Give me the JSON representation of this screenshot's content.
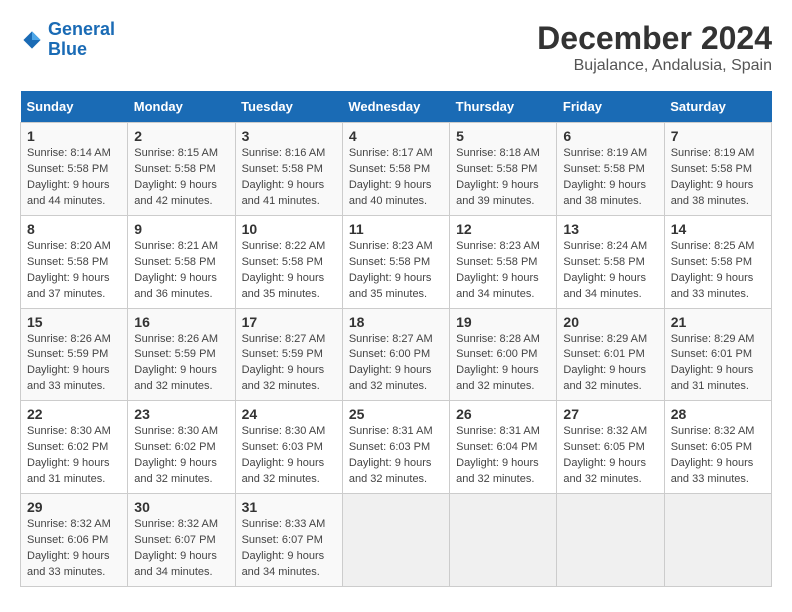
{
  "logo": {
    "line1": "General",
    "line2": "Blue"
  },
  "title": "December 2024",
  "subtitle": "Bujalance, Andalusia, Spain",
  "days_header": [
    "Sunday",
    "Monday",
    "Tuesday",
    "Wednesday",
    "Thursday",
    "Friday",
    "Saturday"
  ],
  "weeks": [
    [
      {
        "day": "1",
        "sunrise": "Sunrise: 8:14 AM",
        "sunset": "Sunset: 5:58 PM",
        "daylight": "Daylight: 9 hours and 44 minutes."
      },
      {
        "day": "2",
        "sunrise": "Sunrise: 8:15 AM",
        "sunset": "Sunset: 5:58 PM",
        "daylight": "Daylight: 9 hours and 42 minutes."
      },
      {
        "day": "3",
        "sunrise": "Sunrise: 8:16 AM",
        "sunset": "Sunset: 5:58 PM",
        "daylight": "Daylight: 9 hours and 41 minutes."
      },
      {
        "day": "4",
        "sunrise": "Sunrise: 8:17 AM",
        "sunset": "Sunset: 5:58 PM",
        "daylight": "Daylight: 9 hours and 40 minutes."
      },
      {
        "day": "5",
        "sunrise": "Sunrise: 8:18 AM",
        "sunset": "Sunset: 5:58 PM",
        "daylight": "Daylight: 9 hours and 39 minutes."
      },
      {
        "day": "6",
        "sunrise": "Sunrise: 8:19 AM",
        "sunset": "Sunset: 5:58 PM",
        "daylight": "Daylight: 9 hours and 38 minutes."
      },
      {
        "day": "7",
        "sunrise": "Sunrise: 8:19 AM",
        "sunset": "Sunset: 5:58 PM",
        "daylight": "Daylight: 9 hours and 38 minutes."
      }
    ],
    [
      {
        "day": "8",
        "sunrise": "Sunrise: 8:20 AM",
        "sunset": "Sunset: 5:58 PM",
        "daylight": "Daylight: 9 hours and 37 minutes."
      },
      {
        "day": "9",
        "sunrise": "Sunrise: 8:21 AM",
        "sunset": "Sunset: 5:58 PM",
        "daylight": "Daylight: 9 hours and 36 minutes."
      },
      {
        "day": "10",
        "sunrise": "Sunrise: 8:22 AM",
        "sunset": "Sunset: 5:58 PM",
        "daylight": "Daylight: 9 hours and 35 minutes."
      },
      {
        "day": "11",
        "sunrise": "Sunrise: 8:23 AM",
        "sunset": "Sunset: 5:58 PM",
        "daylight": "Daylight: 9 hours and 35 minutes."
      },
      {
        "day": "12",
        "sunrise": "Sunrise: 8:23 AM",
        "sunset": "Sunset: 5:58 PM",
        "daylight": "Daylight: 9 hours and 34 minutes."
      },
      {
        "day": "13",
        "sunrise": "Sunrise: 8:24 AM",
        "sunset": "Sunset: 5:58 PM",
        "daylight": "Daylight: 9 hours and 34 minutes."
      },
      {
        "day": "14",
        "sunrise": "Sunrise: 8:25 AM",
        "sunset": "Sunset: 5:58 PM",
        "daylight": "Daylight: 9 hours and 33 minutes."
      }
    ],
    [
      {
        "day": "15",
        "sunrise": "Sunrise: 8:26 AM",
        "sunset": "Sunset: 5:59 PM",
        "daylight": "Daylight: 9 hours and 33 minutes."
      },
      {
        "day": "16",
        "sunrise": "Sunrise: 8:26 AM",
        "sunset": "Sunset: 5:59 PM",
        "daylight": "Daylight: 9 hours and 32 minutes."
      },
      {
        "day": "17",
        "sunrise": "Sunrise: 8:27 AM",
        "sunset": "Sunset: 5:59 PM",
        "daylight": "Daylight: 9 hours and 32 minutes."
      },
      {
        "day": "18",
        "sunrise": "Sunrise: 8:27 AM",
        "sunset": "Sunset: 6:00 PM",
        "daylight": "Daylight: 9 hours and 32 minutes."
      },
      {
        "day": "19",
        "sunrise": "Sunrise: 8:28 AM",
        "sunset": "Sunset: 6:00 PM",
        "daylight": "Daylight: 9 hours and 32 minutes."
      },
      {
        "day": "20",
        "sunrise": "Sunrise: 8:29 AM",
        "sunset": "Sunset: 6:01 PM",
        "daylight": "Daylight: 9 hours and 32 minutes."
      },
      {
        "day": "21",
        "sunrise": "Sunrise: 8:29 AM",
        "sunset": "Sunset: 6:01 PM",
        "daylight": "Daylight: 9 hours and 31 minutes."
      }
    ],
    [
      {
        "day": "22",
        "sunrise": "Sunrise: 8:30 AM",
        "sunset": "Sunset: 6:02 PM",
        "daylight": "Daylight: 9 hours and 31 minutes."
      },
      {
        "day": "23",
        "sunrise": "Sunrise: 8:30 AM",
        "sunset": "Sunset: 6:02 PM",
        "daylight": "Daylight: 9 hours and 32 minutes."
      },
      {
        "day": "24",
        "sunrise": "Sunrise: 8:30 AM",
        "sunset": "Sunset: 6:03 PM",
        "daylight": "Daylight: 9 hours and 32 minutes."
      },
      {
        "day": "25",
        "sunrise": "Sunrise: 8:31 AM",
        "sunset": "Sunset: 6:03 PM",
        "daylight": "Daylight: 9 hours and 32 minutes."
      },
      {
        "day": "26",
        "sunrise": "Sunrise: 8:31 AM",
        "sunset": "Sunset: 6:04 PM",
        "daylight": "Daylight: 9 hours and 32 minutes."
      },
      {
        "day": "27",
        "sunrise": "Sunrise: 8:32 AM",
        "sunset": "Sunset: 6:05 PM",
        "daylight": "Daylight: 9 hours and 32 minutes."
      },
      {
        "day": "28",
        "sunrise": "Sunrise: 8:32 AM",
        "sunset": "Sunset: 6:05 PM",
        "daylight": "Daylight: 9 hours and 33 minutes."
      }
    ],
    [
      {
        "day": "29",
        "sunrise": "Sunrise: 8:32 AM",
        "sunset": "Sunset: 6:06 PM",
        "daylight": "Daylight: 9 hours and 33 minutes."
      },
      {
        "day": "30",
        "sunrise": "Sunrise: 8:32 AM",
        "sunset": "Sunset: 6:07 PM",
        "daylight": "Daylight: 9 hours and 34 minutes."
      },
      {
        "day": "31",
        "sunrise": "Sunrise: 8:33 AM",
        "sunset": "Sunset: 6:07 PM",
        "daylight": "Daylight: 9 hours and 34 minutes."
      },
      null,
      null,
      null,
      null
    ]
  ]
}
